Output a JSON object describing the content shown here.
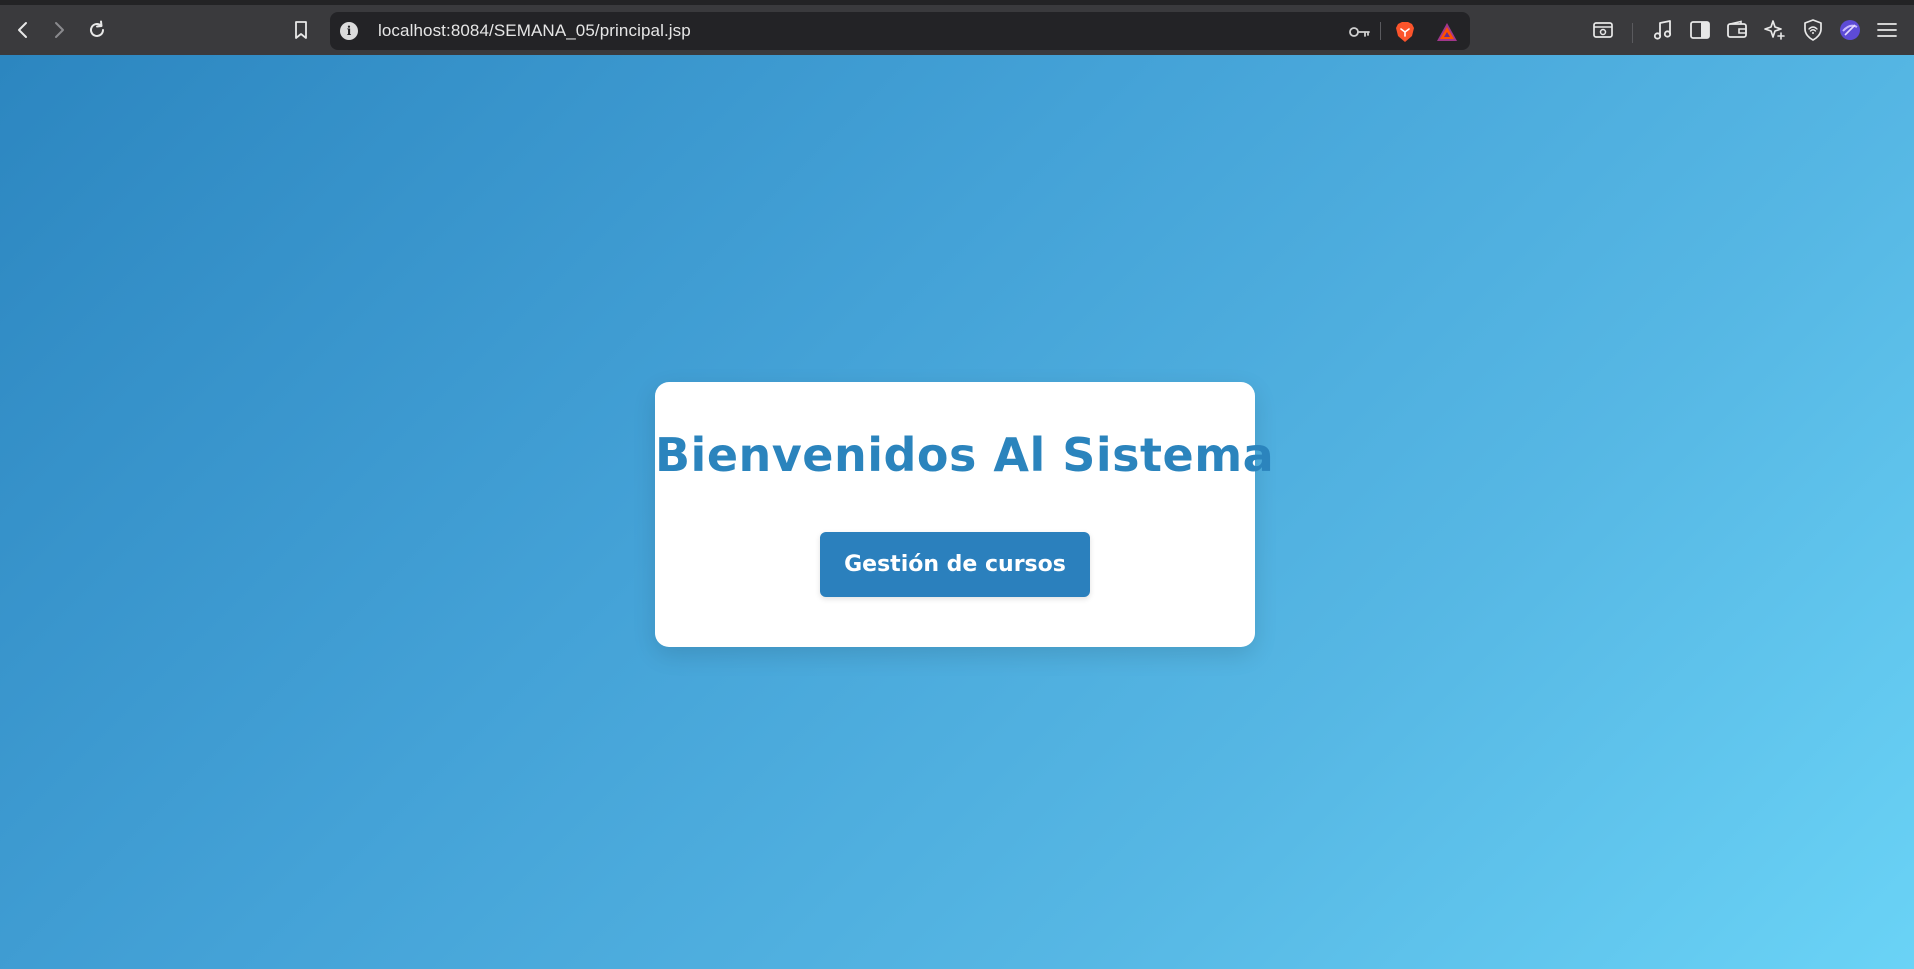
{
  "browser": {
    "url": "localhost:8084/SEMANA_05/principal.jsp",
    "icons": {
      "back": "chevron-left-icon",
      "forward": "chevron-right-icon",
      "reload": "reload-icon",
      "bookmark": "bookmark-icon",
      "site_info": "info-icon",
      "key": "key-icon",
      "brave_shields": "brave-lion-icon",
      "rewards": "triangle-icon",
      "screenshot": "screenshot-icon",
      "media": "music-note-icon",
      "sidebar": "sidebar-icon",
      "wallet": "wallet-icon",
      "leo": "sparkle-icon",
      "vpn": "vpn-shield-icon",
      "profile": "profile-icon",
      "menu": "menu-icon"
    },
    "info_glyph": "i"
  },
  "page": {
    "title": "Bienvenidos Al Sistema",
    "button_label": "Gestión de cursos"
  },
  "colors": {
    "accent": "#2b80bd",
    "title": "#2b84bd",
    "gradient_start": "#2c86c0",
    "gradient_end": "#6ad3f6",
    "card": "#ffffff"
  }
}
